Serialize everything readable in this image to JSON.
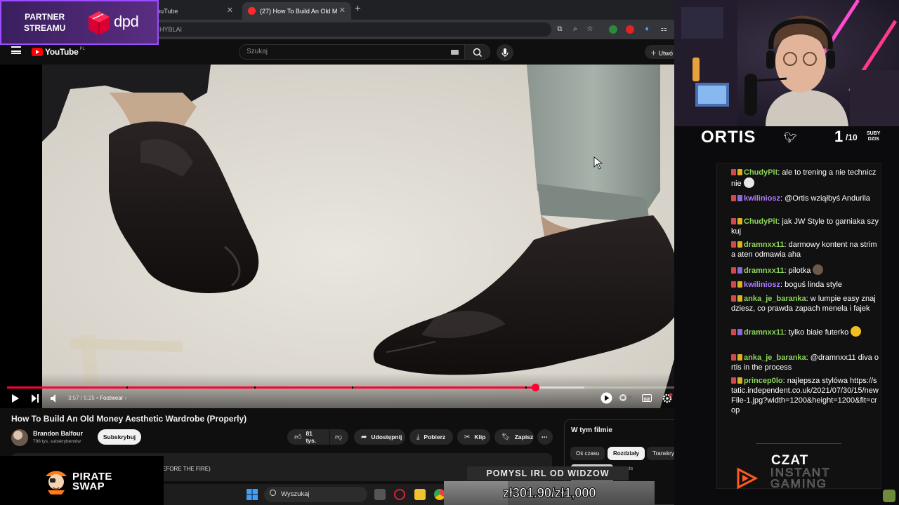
{
  "browser": {
    "tabs": [
      {
        "label": "YouTube"
      },
      {
        "label": "(27) How To Build An Old Mon"
      }
    ],
    "address_fragment": "HYBLAI"
  },
  "youtube": {
    "logo_text": "YouTube",
    "country": "PL",
    "search_placeholder": "Szukaj",
    "create_label": "Utwó"
  },
  "player": {
    "time": "3:57 / 5:25",
    "chapter": "Footwear",
    "progress": 0.76,
    "buffered": 0.83,
    "chapter_marks": [
      0.172,
      0.356,
      0.496,
      0.745
    ]
  },
  "video": {
    "title": "How To Build An Old Money Aesthetic Wardrobe (Properly)",
    "channel": "Brandon Balfour",
    "subscribers": "798 tys. subskrybentów",
    "subscribe_label": "Subskrybuj",
    "likes": "81 tys.",
    "share_label": "Udostępnij",
    "download_label": "Pobierz",
    "clip_label": "Klip",
    "save_label": "Zapisz",
    "description_fragment": "EFORE THE FIRE)"
  },
  "in_video": {
    "title": "W tym filmie",
    "chips": [
      "Oś czasu",
      "Rozdziały",
      "Transkrypcja"
    ],
    "active_chip": "Rozdziały",
    "chapter_label": "Coats"
  },
  "overlays": {
    "partner_line1": "PARTNER",
    "partner_line2": "STREAMU",
    "sponsor": "dpd",
    "streamer": "ORTIS",
    "subs_count": "1",
    "subs_goal": "/10",
    "subs_label1": "SUBY",
    "subs_label2": "DZIS",
    "pirate_line1": "PIRATE",
    "pirate_line2": "SWAP",
    "irl_banner": "POMYSL IRL OD WIDZOW",
    "goal_text": "zł301.90/zł1,000",
    "goal_fraction": 0.3019,
    "czat_title": "CZAT",
    "czat_line1": "INSTANT",
    "czat_line2": "GAMING",
    "colors": {
      "accent": "#ff0033",
      "partner_bg": "#5a2d82",
      "chat_green": "#8cd65a",
      "chat_purple": "#b07bff"
    }
  },
  "chat": [
    {
      "user": "ChudyPit",
      "color": "#8cd65a",
      "text": "ale to trening a nie technicznie"
    },
    {
      "user": "kwiliniosz",
      "color": "#b07bff",
      "text": "@Ortis wziąłbyś Andurila"
    },
    {
      "user": "ChudyPit",
      "color": "#8cd65a",
      "text": "jak JW Style to garniaka szykuj"
    },
    {
      "user": "dramnxx11",
      "color": "#8cd65a",
      "text": "darmowy kontent na strima aten odmawia aha"
    },
    {
      "user": "dramnxx11",
      "color": "#8cd65a",
      "text": "pilotka"
    },
    {
      "user": "kwiliniosz",
      "color": "#b07bff",
      "text": "boguś linda style"
    },
    {
      "user": "anka_je_baranka",
      "color": "#8cd65a",
      "text": "w lumpie easy znajdziesz, co prawda zapach menela i fajek"
    },
    {
      "user": "dramnxx11",
      "color": "#8cd65a",
      "text": "tylko białe futerko"
    },
    {
      "user": "anka_je_baranka",
      "color": "#8cd65a",
      "text": "@dramnxx11 diva ortis in the process"
    },
    {
      "user": "princep0lo",
      "color": "#8cd65a",
      "text": "najlepsza stylówa https://static.independent.co.uk/2021/07/30/15/newFile-1.jpg?width=1200&height=1200&fit=crop"
    }
  ],
  "taskbar": {
    "search_label": "Wyszukaj"
  }
}
